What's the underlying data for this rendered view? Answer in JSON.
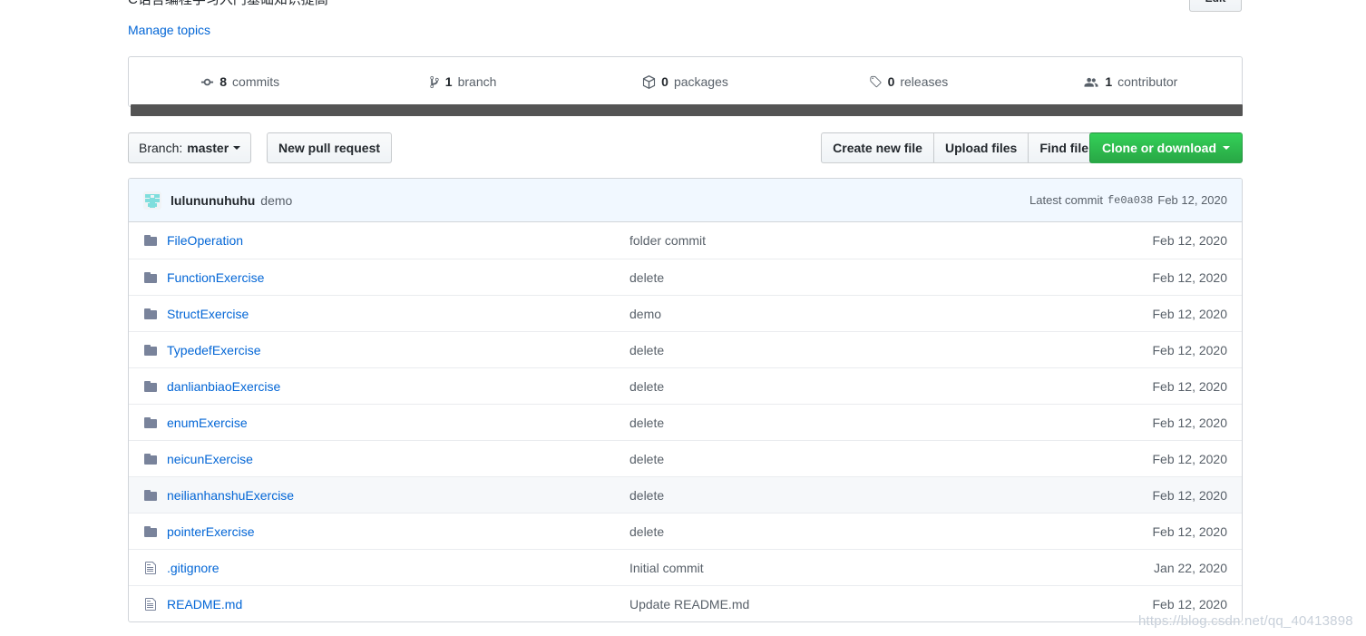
{
  "header": {
    "topic_description": "C语言编程学习入门基础知识提高",
    "edit_label": "Edit",
    "manage_topics_label": "Manage topics"
  },
  "summary": {
    "items": [
      {
        "count": "8",
        "label": "commits",
        "icon": "git-commit-icon"
      },
      {
        "count": "1",
        "label": "branch",
        "icon": "git-branch-icon"
      },
      {
        "count": "0",
        "label": "packages",
        "icon": "package-icon"
      },
      {
        "count": "0",
        "label": "releases",
        "icon": "tag-icon"
      },
      {
        "count": "1",
        "label": "contributor",
        "icon": "people-icon"
      }
    ]
  },
  "toolbar": {
    "branch_prefix": "Branch:",
    "branch_name": "master",
    "new_pull_request_label": "New pull request",
    "create_new_file_label": "Create new file",
    "upload_files_label": "Upload files",
    "find_file_label": "Find file",
    "clone_label": "Clone or download",
    "clone_color": "#28a745"
  },
  "latest_commit": {
    "author": "lulununuhuhu",
    "message": "demo",
    "prefix": "Latest commit",
    "sha": "fe0a038",
    "date": "Feb 12, 2020"
  },
  "file_table": {
    "rows": [
      {
        "type": "folder",
        "name": "FileOperation",
        "message": "folder commit",
        "date": "Feb 12, 2020",
        "highlighted": false
      },
      {
        "type": "folder",
        "name": "FunctionExercise",
        "message": "delete",
        "date": "Feb 12, 2020",
        "highlighted": false
      },
      {
        "type": "folder",
        "name": "StructExercise",
        "message": "demo",
        "date": "Feb 12, 2020",
        "highlighted": false
      },
      {
        "type": "folder",
        "name": "TypedefExercise",
        "message": "delete",
        "date": "Feb 12, 2020",
        "highlighted": false
      },
      {
        "type": "folder",
        "name": "danlianbiaoExercise",
        "message": "delete",
        "date": "Feb 12, 2020",
        "highlighted": false
      },
      {
        "type": "folder",
        "name": "enumExercise",
        "message": "delete",
        "date": "Feb 12, 2020",
        "highlighted": false
      },
      {
        "type": "folder",
        "name": "neicunExercise",
        "message": "delete",
        "date": "Feb 12, 2020",
        "highlighted": false
      },
      {
        "type": "folder",
        "name": "neilianhanshuExercise",
        "message": "delete",
        "date": "Feb 12, 2020",
        "highlighted": true
      },
      {
        "type": "folder",
        "name": "pointerExercise",
        "message": "delete",
        "date": "Feb 12, 2020",
        "highlighted": false
      },
      {
        "type": "file",
        "name": ".gitignore",
        "message": "Initial commit",
        "date": "Jan 22, 2020",
        "highlighted": false
      },
      {
        "type": "file",
        "name": "README.md",
        "message": "Update README.md",
        "date": "Feb 12, 2020",
        "highlighted": false
      }
    ]
  },
  "watermark": {
    "text": "https://blog.csdn.net/qq_40413898"
  }
}
